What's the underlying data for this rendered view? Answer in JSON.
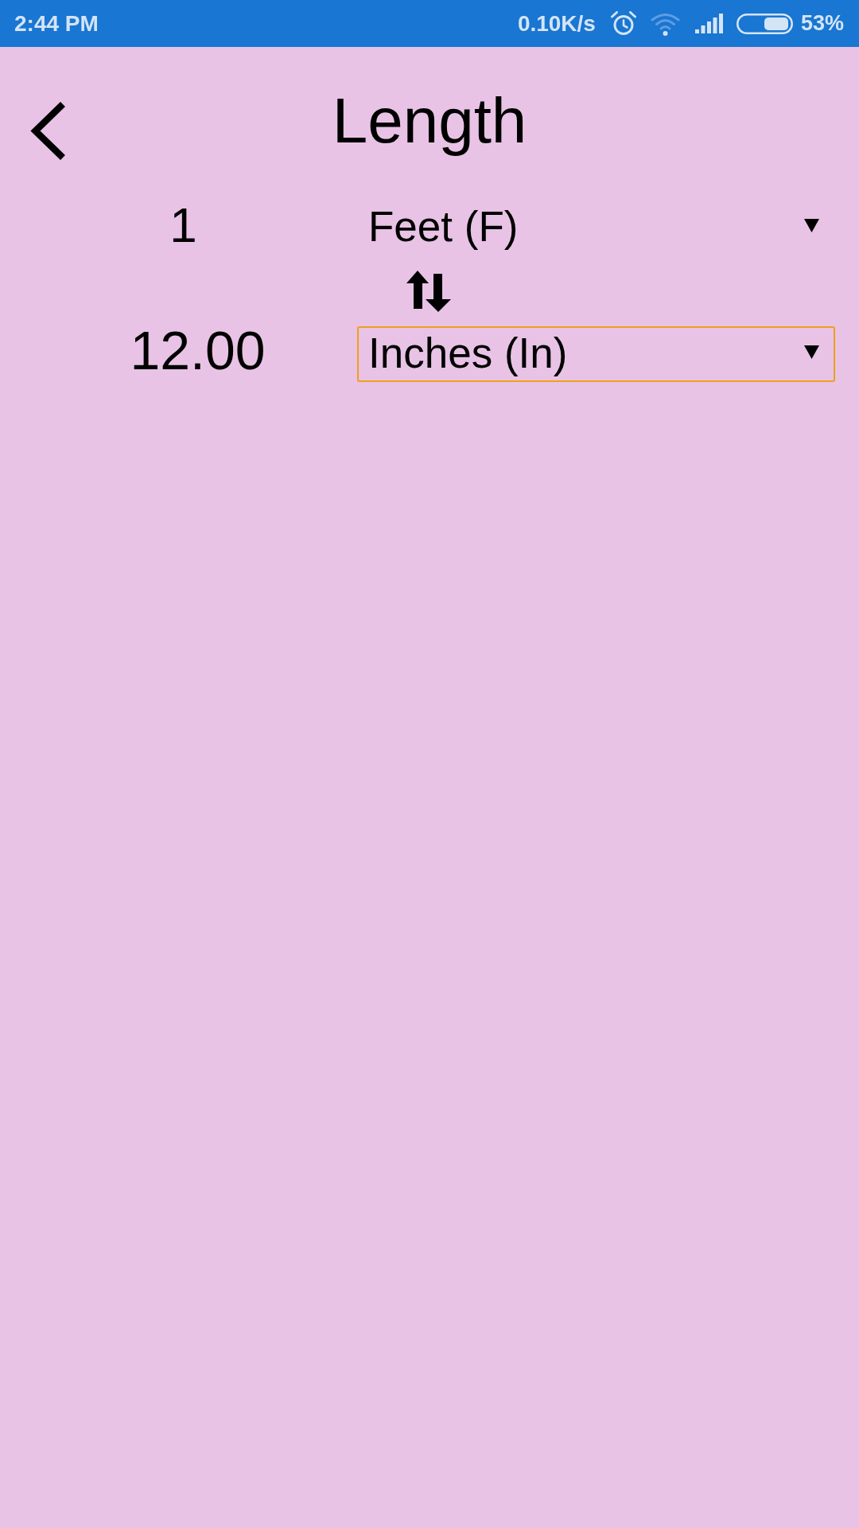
{
  "status_bar": {
    "time": "2:44 PM",
    "network_speed": "0.10K/s",
    "battery_percent": "53%"
  },
  "header": {
    "title": "Length"
  },
  "rows": [
    {
      "kind": "input",
      "value": "1",
      "unit": "Feet (F)",
      "focused": false
    },
    {
      "kind": "result",
      "value": "12.00",
      "unit": "Inches (In)",
      "focused": true
    }
  ]
}
